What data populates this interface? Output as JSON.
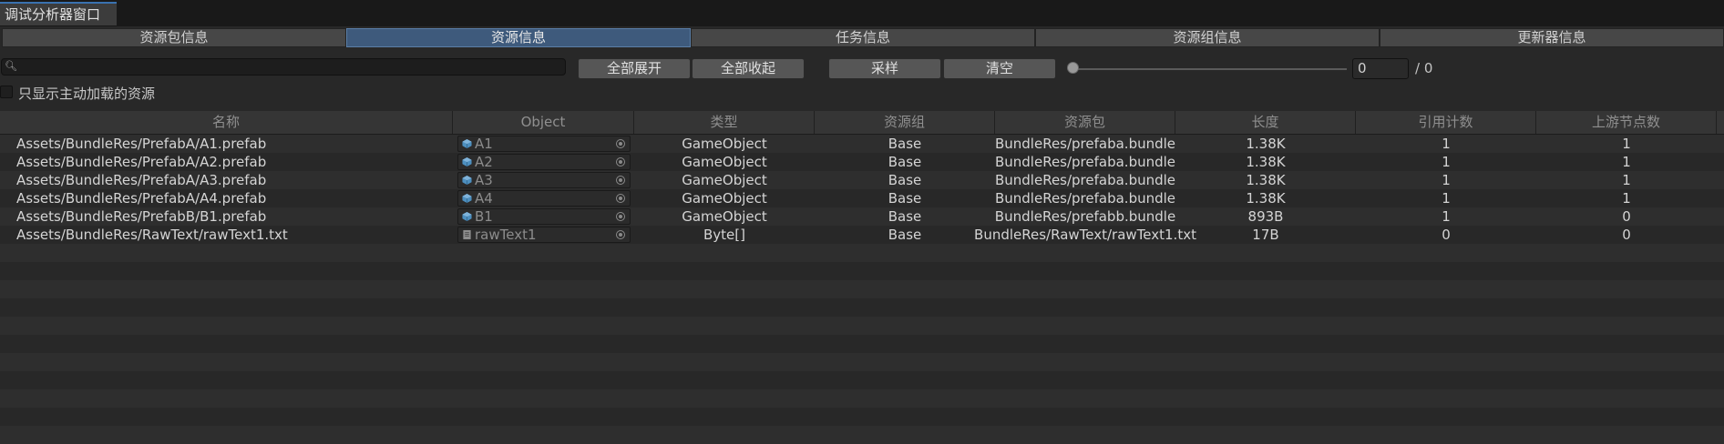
{
  "window": {
    "title": "调试分析器窗口"
  },
  "tabs": [
    {
      "label": "资源包信息"
    },
    {
      "label": "资源信息"
    },
    {
      "label": "任务信息"
    },
    {
      "label": "资源组信息"
    },
    {
      "label": "更新器信息"
    }
  ],
  "active_tab": "资源信息",
  "search": {
    "value": "",
    "placeholder": ""
  },
  "buttons": {
    "expand_all": "全部展开",
    "collapse_all": "全部收起",
    "sample": "采样",
    "clear": "清空"
  },
  "frame": {
    "slider_value": 0,
    "value": "0",
    "total": "/ 0"
  },
  "filter": {
    "label": "只显示主动加载的资源",
    "checked": false
  },
  "columns": [
    "名称",
    "Object",
    "类型",
    "资源组",
    "资源包",
    "长度",
    "引用计数",
    "上游节点数"
  ],
  "rows": [
    {
      "name": "Assets/BundleRes/PrefabA/A1.prefab",
      "object": "A1",
      "object_icon": "prefab-icon",
      "type": "GameObject",
      "group": "Base",
      "bundle": "BundleRes/prefaba.bundle",
      "size": "1.38K",
      "refs": "1",
      "upstream": "1"
    },
    {
      "name": "Assets/BundleRes/PrefabA/A2.prefab",
      "object": "A2",
      "object_icon": "prefab-icon",
      "type": "GameObject",
      "group": "Base",
      "bundle": "BundleRes/prefaba.bundle",
      "size": "1.38K",
      "refs": "1",
      "upstream": "1"
    },
    {
      "name": "Assets/BundleRes/PrefabA/A3.prefab",
      "object": "A3",
      "object_icon": "prefab-icon",
      "type": "GameObject",
      "group": "Base",
      "bundle": "BundleRes/prefaba.bundle",
      "size": "1.38K",
      "refs": "1",
      "upstream": "1"
    },
    {
      "name": "Assets/BundleRes/PrefabA/A4.prefab",
      "object": "A4",
      "object_icon": "prefab-icon",
      "type": "GameObject",
      "group": "Base",
      "bundle": "BundleRes/prefaba.bundle",
      "size": "1.38K",
      "refs": "1",
      "upstream": "1"
    },
    {
      "name": "Assets/BundleRes/PrefabB/B1.prefab",
      "object": "B1",
      "object_icon": "prefab-icon",
      "type": "GameObject",
      "group": "Base",
      "bundle": "BundleRes/prefabb.bundle",
      "size": "893B",
      "refs": "1",
      "upstream": "0"
    },
    {
      "name": "Assets/BundleRes/RawText/rawText1.txt",
      "object": "rawText1",
      "object_icon": "text-file-icon",
      "type": "Byte[]",
      "group": "Base",
      "bundle": "BundleRes/RawText/rawText1.txt",
      "size": "17B",
      "refs": "0",
      "upstream": "0"
    }
  ],
  "colors": {
    "background": "#282828",
    "active_tab": "#3e5a7c",
    "header": "#353535",
    "prefab_icon": "#4d8fbf"
  }
}
